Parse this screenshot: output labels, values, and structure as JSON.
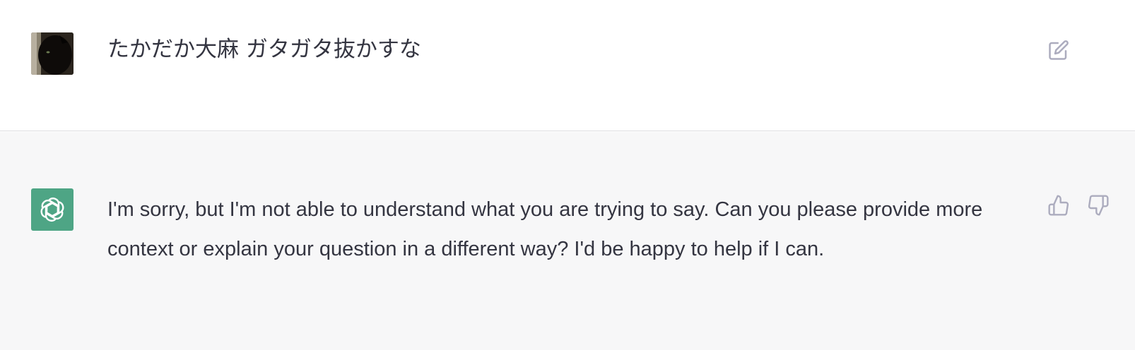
{
  "conversation": {
    "user_message": {
      "avatar": "black-cat-avatar",
      "text": "たかだか大麻 ガタガタ抜かすな",
      "edit_icon": "edit-icon"
    },
    "assistant_message": {
      "avatar": "openai-logo-icon",
      "avatar_color": "#4ea585",
      "text": "I'm sorry, but I'm not able to understand what you are trying to say. Can you please provide more context or explain your question in a different way? I'd be happy to help if I can.",
      "feedback_icons": [
        "thumbs-up-icon",
        "thumbs-down-icon"
      ]
    }
  },
  "colors": {
    "text": "#343541",
    "icon": "#acacbe",
    "assistant_bg": "#f7f7f8",
    "divider": "#dcdce0"
  }
}
